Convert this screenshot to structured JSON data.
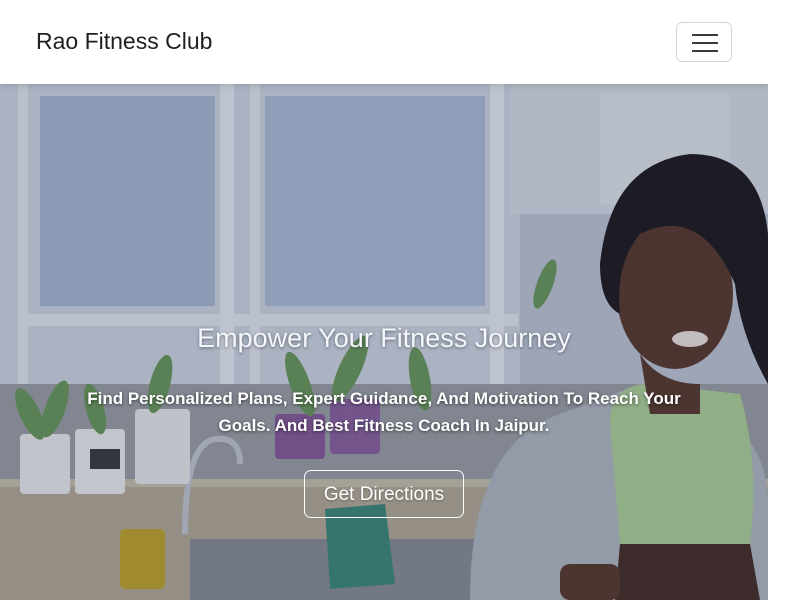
{
  "navbar": {
    "brand": "Rao Fitness Club",
    "toggler_icon": "hamburger-menu-icon"
  },
  "hero": {
    "title": "Empower Your Fitness Journey",
    "subtitle": "Find Personalized Plans, Expert Guidance, And Motivation To Reach Your Goals. And Best Fitness Coach In Jaipur.",
    "cta_label": "Get Directions",
    "background_image": "woman-in-kitchen-photo"
  },
  "colors": {
    "navbar_bg": "#ffffff",
    "brand_text": "#1f1f1f",
    "hero_text": "#ffffff",
    "overlay": "#19234638"
  }
}
